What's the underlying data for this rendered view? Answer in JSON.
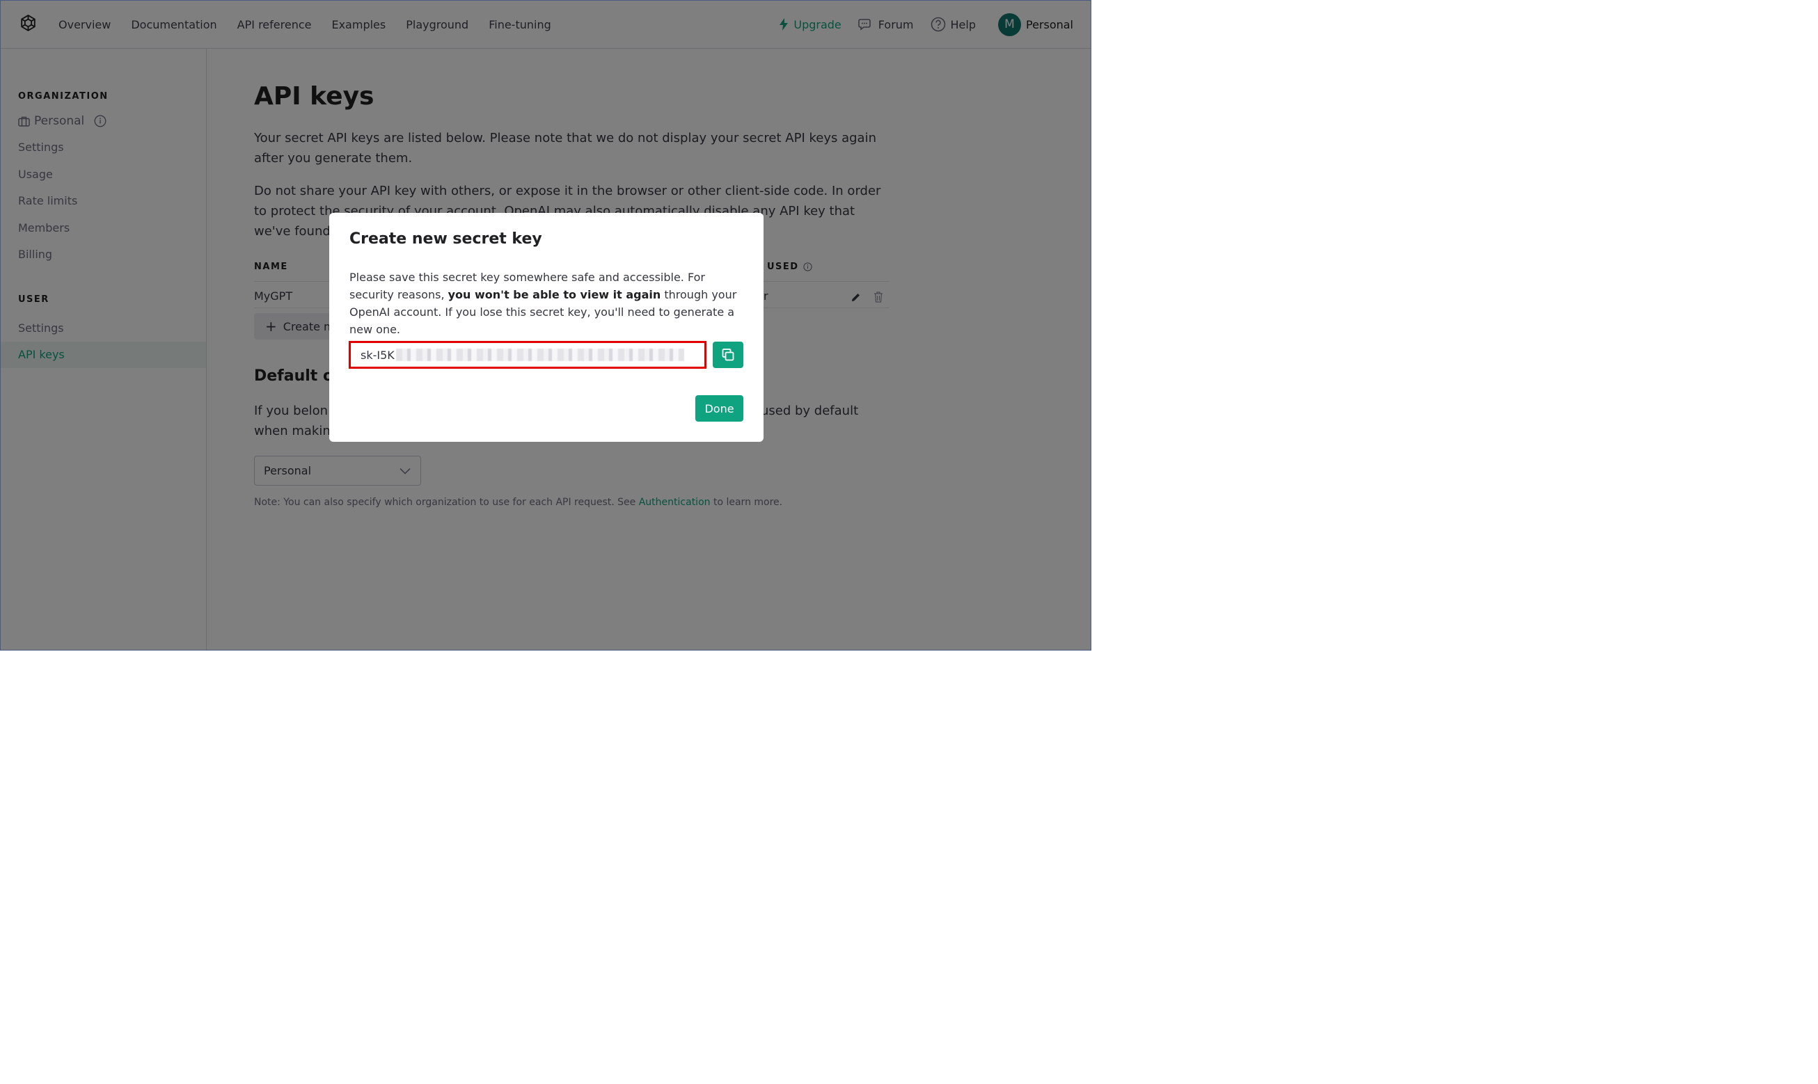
{
  "header": {
    "nav": [
      "Overview",
      "Documentation",
      "API reference",
      "Examples",
      "Playground",
      "Fine-tuning"
    ],
    "upgrade": "Upgrade",
    "forum": "Forum",
    "help": "Help",
    "avatar_letter": "M",
    "account": "Personal"
  },
  "sidebar": {
    "org_heading": "ORGANIZATION",
    "org_name": "Personal",
    "org_items": [
      "Settings",
      "Usage",
      "Rate limits",
      "Members",
      "Billing"
    ],
    "user_heading": "USER",
    "user_items": [
      "Settings",
      "API keys"
    ],
    "active": "API keys"
  },
  "main": {
    "title": "API keys",
    "para1": "Your secret API keys are listed below. Please note that we do not display your secret API keys again after you generate them.",
    "para2": "Do not share your API key with others, or expose it in the browser or other client-side code. In order to protect the security of your account, OpenAI may also automatically disable any API key that we've found has le",
    "table": {
      "col_name": "NAME",
      "col_used": "USED",
      "rows": [
        {
          "name": "MyGPT",
          "last_used_fragment": "r"
        }
      ]
    },
    "create_label": "Create ne",
    "default_org_title": "Default or",
    "para3_line1": "If you belon",
    "para3_line1_tail": "used by default",
    "para3_line2": "when makin",
    "select_value": "Personal",
    "note_prefix": "Note: You can also specify which organization to use for each API request. See ",
    "note_link": "Authentication",
    "note_suffix": " to learn more."
  },
  "modal": {
    "title": "Create new secret key",
    "text_pre": "Please save this secret key somewhere safe and accessible. For security reasons, ",
    "text_bold": "you won't be able to view it again",
    "text_post": " through your OpenAI account. If you lose this secret key, you'll need to generate a new one.",
    "key_prefix": "sk-I5K",
    "done_label": "Done"
  },
  "colors": {
    "accent": "#10a37f",
    "highlight_border": "#e00000",
    "avatar_bg": "#10766b"
  }
}
